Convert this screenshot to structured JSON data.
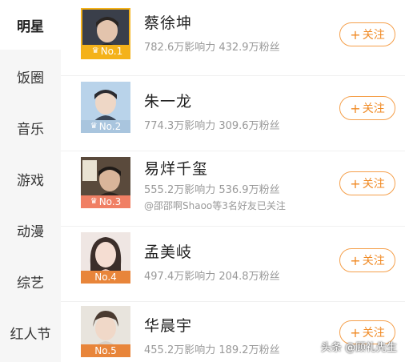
{
  "sidebar": {
    "items": [
      {
        "label": "明星"
      },
      {
        "label": "饭圈"
      },
      {
        "label": "音乐"
      },
      {
        "label": "游戏"
      },
      {
        "label": "动漫"
      },
      {
        "label": "综艺"
      },
      {
        "label": "红人节"
      }
    ]
  },
  "colors": {
    "accent": "#f08a24",
    "badge_gold": "#f4b21a",
    "badge_silver": "#a9c5de",
    "badge_bronze": "#f07f64",
    "badge_other": "#e8853a"
  },
  "list": {
    "follow_label": "关注",
    "items": [
      {
        "rank": "No.1",
        "name": "蔡徐坤",
        "stats": "782.6万影响力 432.9万粉丝"
      },
      {
        "rank": "No.2",
        "name": "朱一龙",
        "stats": "774.3万影响力 309.6万粉丝"
      },
      {
        "rank": "No.3",
        "name": "易烊千玺",
        "stats": "555.2万影响力 536.9万粉丝",
        "friends": "@邵邵啊Shaoo等3名好友已关注"
      },
      {
        "rank": "No.4",
        "name": "孟美岐",
        "stats": "497.4万影响力 204.8万粉丝"
      },
      {
        "rank": "No.5",
        "name": "华晨宇",
        "stats": "455.2万影响力 189.2万粉丝"
      }
    ]
  },
  "watermark": "头条 @顾礼先生"
}
